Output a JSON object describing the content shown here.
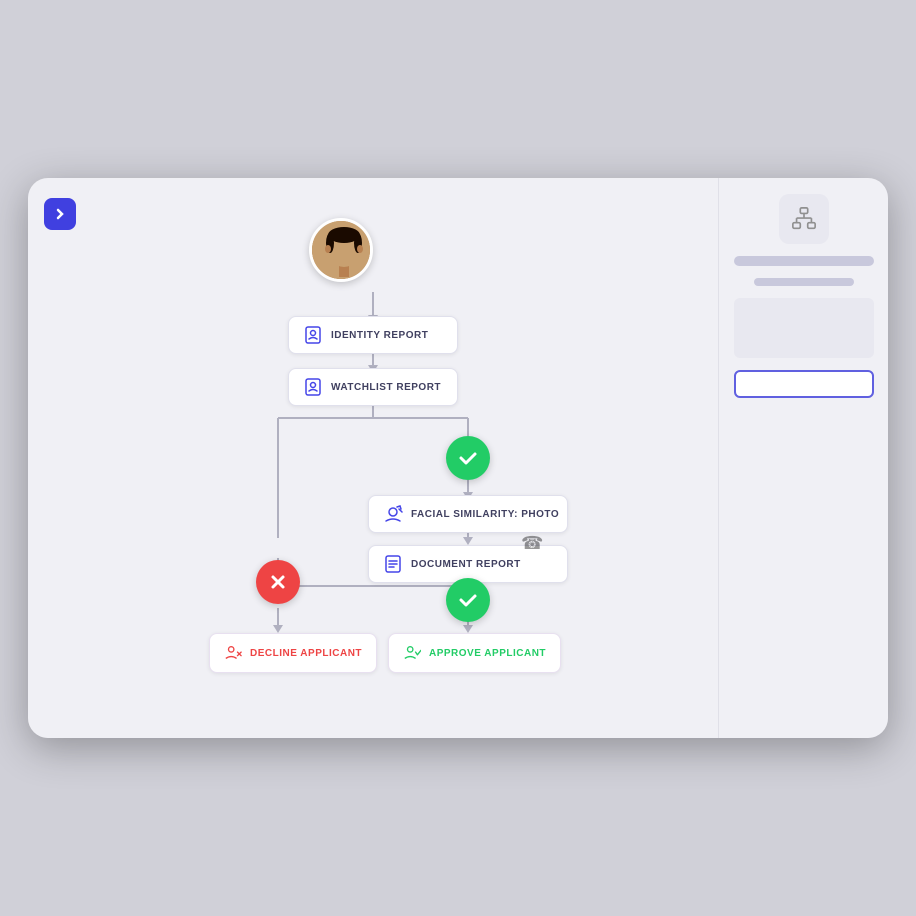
{
  "device": {
    "background": "#d0d4de"
  },
  "toggle_button": {
    "icon": "›",
    "color": "#4545e8"
  },
  "flow": {
    "nodes": {
      "identity_report": {
        "label": "IDENTITY REPORT",
        "icon": "document-check"
      },
      "watchlist_report": {
        "label": "WATCHLIST REPORT",
        "icon": "document-check"
      },
      "facial_similarity": {
        "label": "FACIAL SIMILARITY: PHOTO",
        "icon": "camera-check"
      },
      "document_report": {
        "label": "DOCUMENT REPORT",
        "icon": "document-list"
      },
      "decline_applicant": {
        "label": "DECLINE APPLICANT",
        "icon": "user-x"
      },
      "approve_applicant": {
        "label": "APPROVE APPLICANT",
        "icon": "user-check"
      }
    },
    "decisions": {
      "approve1": {
        "type": "approve",
        "symbol": "✓"
      },
      "approve2": {
        "type": "approve",
        "symbol": "✓"
      },
      "decline1": {
        "type": "decline",
        "symbol": "✗"
      }
    }
  },
  "sidebar": {
    "network_icon": "network-diagram"
  }
}
